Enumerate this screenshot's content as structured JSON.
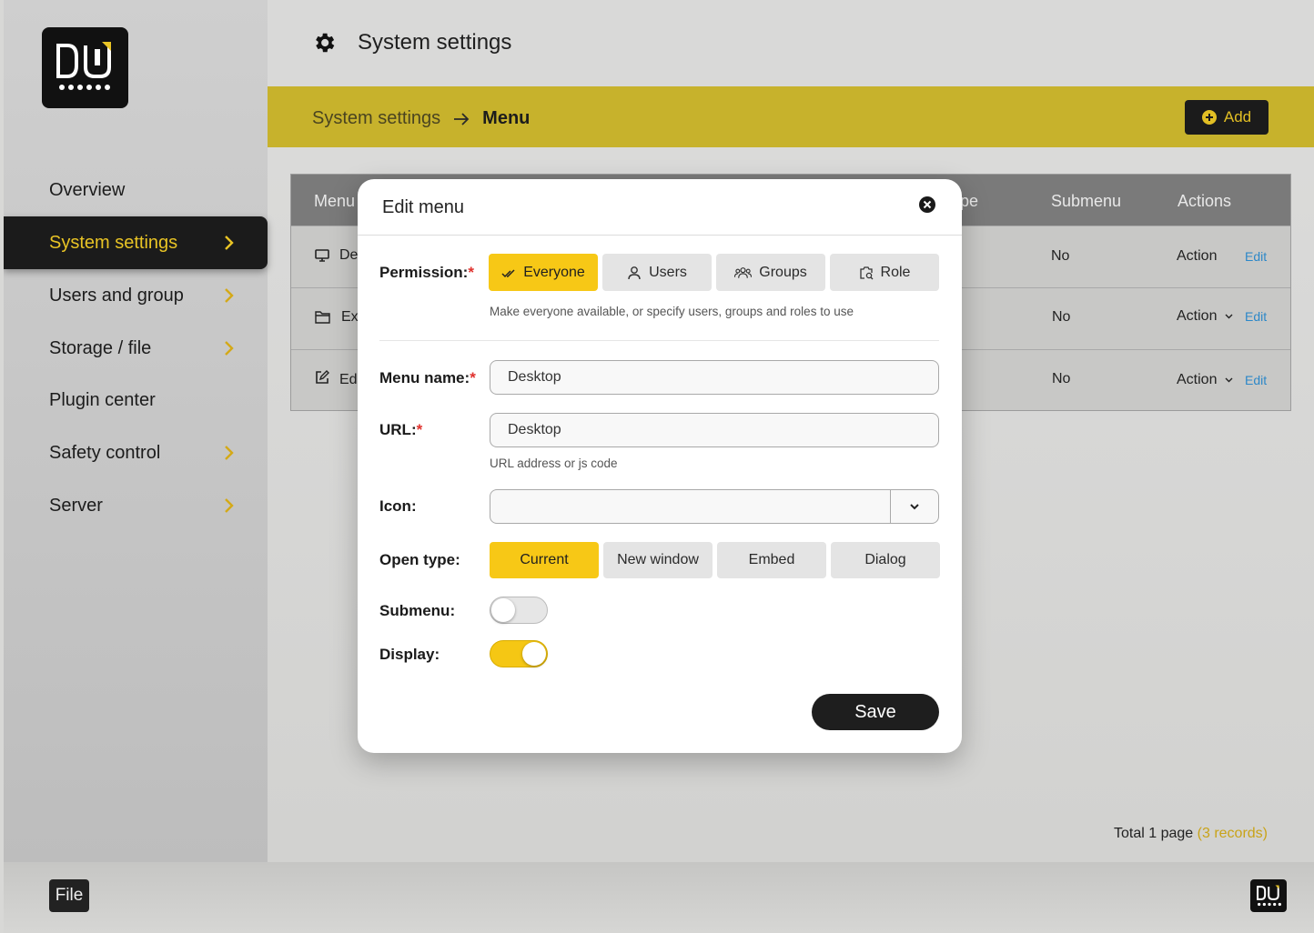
{
  "header": {
    "title": "System settings"
  },
  "breadcrumb": {
    "parent": "System settings",
    "current": "Menu"
  },
  "add_button": {
    "label": "Add"
  },
  "sidebar": {
    "items": [
      {
        "label": "Overview",
        "has_chevron": false
      },
      {
        "label": "System settings",
        "has_chevron": true,
        "active": true
      },
      {
        "label": "Users and group",
        "has_chevron": true
      },
      {
        "label": "Storage / file",
        "has_chevron": true
      },
      {
        "label": "Plugin center",
        "has_chevron": false
      },
      {
        "label": "Safety control",
        "has_chevron": true
      },
      {
        "label": "Server",
        "has_chevron": true
      }
    ]
  },
  "table": {
    "columns": [
      "Menu",
      "pe",
      "Submenu",
      "Actions"
    ],
    "rows": [
      {
        "icon": "monitor-icon",
        "name": "De",
        "submenu": "No",
        "action": "Action",
        "edit": "Edit"
      },
      {
        "icon": "folder-icon",
        "name": "Ex",
        "submenu": "No",
        "action": "Action",
        "edit": "Edit"
      },
      {
        "icon": "edit-icon",
        "name": "Ed",
        "submenu": "No",
        "action": "Action",
        "edit": "Edit"
      }
    ]
  },
  "footer": {
    "total": "Total 1 page",
    "records": "(3 records)"
  },
  "dock": {
    "file_label": "File"
  },
  "modal": {
    "title": "Edit menu",
    "permission": {
      "label": "Permission:",
      "options": [
        "Everyone",
        "Users",
        "Groups",
        "Role"
      ],
      "selected": "Everyone",
      "hint": "Make everyone available, or specify users, groups and roles  to use"
    },
    "menu_name": {
      "label": "Menu name:",
      "value": "Desktop"
    },
    "url": {
      "label": "URL:",
      "value": "Desktop",
      "hint": "URL address or js code"
    },
    "icon": {
      "label": "Icon:",
      "value": ""
    },
    "open_type": {
      "label": "Open type:",
      "options": [
        "Current",
        "New window",
        "Embed",
        "Dialog"
      ],
      "selected": "Current"
    },
    "submenu": {
      "label": "Submenu:",
      "enabled": false
    },
    "display": {
      "label": "Display:",
      "enabled": true
    },
    "save_label": "Save"
  },
  "colors": {
    "accent": "#f7c816",
    "banner": "#c7b22c",
    "dark": "#1b1b1b",
    "required": "#e0312d",
    "link": "#2d88c8"
  }
}
